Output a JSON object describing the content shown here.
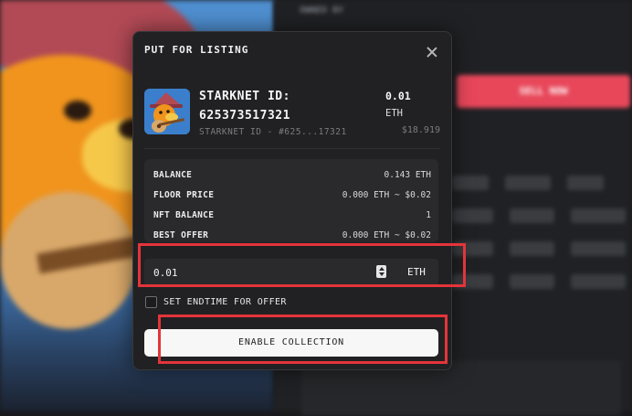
{
  "background": {
    "owned_by_text": "OWNED BY",
    "sell_button_label": "SELL NOW"
  },
  "modal": {
    "title": "PUT FOR LISTING",
    "close_icon": "close-icon",
    "nft": {
      "name": "STARKNET ID: 625373517321",
      "subtitle": "STARKNET ID - #625...17321",
      "price": "0.01",
      "price_unit": "ETH",
      "usd": "$18.919"
    },
    "info": [
      {
        "label": "BALANCE",
        "value": "0.143 ETH"
      },
      {
        "label": "FLOOR PRICE",
        "value": "0.000 ETH ~ $0.02"
      },
      {
        "label": "NFT BALANCE",
        "value": "1"
      },
      {
        "label": "BEST OFFER",
        "value": "0.000 ETH ~ $0.02"
      }
    ],
    "price_input": {
      "value": "0.01",
      "currency": "ETH"
    },
    "endtime": {
      "label": "SET ENDTIME FOR OFFER",
      "checked": false
    },
    "enable_button_label": "ENABLE COLLECTION"
  },
  "highlight_color": "#e4343a"
}
